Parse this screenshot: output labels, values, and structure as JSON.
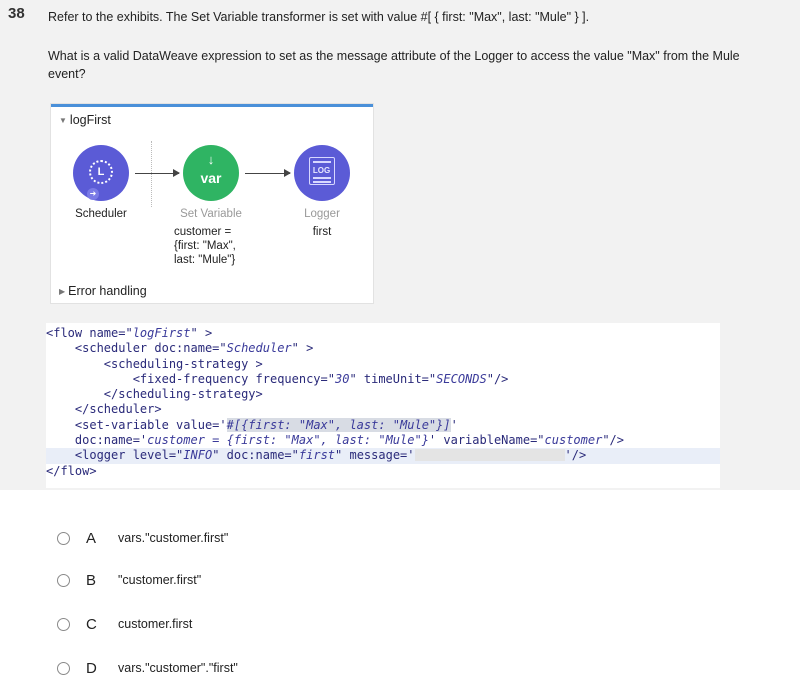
{
  "question": {
    "number": "38",
    "line1": "Refer to the exhibits. The Set Variable transformer is set with value #[ { first: \"Max\", last: \"Mule\" } ].",
    "line2": "What is a valid DataWeave expression to set as the message attribute of the Logger to access the value \"Max\" from the Mule event?"
  },
  "flow": {
    "name": "logFirst",
    "nodes": {
      "scheduler": {
        "label": "Scheduler",
        "icon": "clock-icon",
        "glyph": "L"
      },
      "set_variable": {
        "label": "Set Variable",
        "icon_text": "var",
        "arrow": "↓",
        "detail": [
          "customer =",
          "{first: \"Max\",",
          "last: \"Mule\"}"
        ]
      },
      "logger": {
        "label": "Logger",
        "sub": "first",
        "icon_text": "LOG"
      }
    },
    "error_handling": "Error handling",
    "colors": {
      "scheduler": "#5b5bd6",
      "set_variable": "#2fb463",
      "logger": "#5b5bd6",
      "accent": "#4a90d9"
    }
  },
  "code": {
    "l1a": "<flow name=\"",
    "l1b": "logFirst",
    "l1c": "\" >",
    "l2a": "    <scheduler doc:name=\"",
    "l2b": "Scheduler",
    "l2c": "\" >",
    "l3": "        <scheduling-strategy >",
    "l4a": "            <fixed-frequency frequency=\"",
    "l4b": "30",
    "l4c": "\" timeUnit=\"",
    "l4d": "SECONDS",
    "l4e": "\"/>",
    "l5": "        </scheduling-strategy>",
    "l6": "    </scheduler>",
    "l7a": "    <set-variable value='",
    "l7b": "#[{first: \"Max\", last: \"Mule\"}]",
    "l7c": "'",
    "l8a": "    doc:name='",
    "l8b": "customer = {first: \"Max\", last: \"Mule\"}",
    "l8c": "' variableName=\"",
    "l8d": "customer",
    "l8e": "\"/>",
    "l9a": "    <logger level=\"",
    "l9b": "INFO",
    "l9c": "\" doc:name=\"",
    "l9d": "first",
    "l9e": "\" message='",
    "l9f": "'/>",
    "l10": "</flow>"
  },
  "options": [
    {
      "letter": "A",
      "text": "vars.\"customer.first\""
    },
    {
      "letter": "B",
      "text": "\"customer.first\""
    },
    {
      "letter": "C",
      "text": "customer.first"
    },
    {
      "letter": "D",
      "text": "vars.\"customer\".\"first\""
    }
  ]
}
